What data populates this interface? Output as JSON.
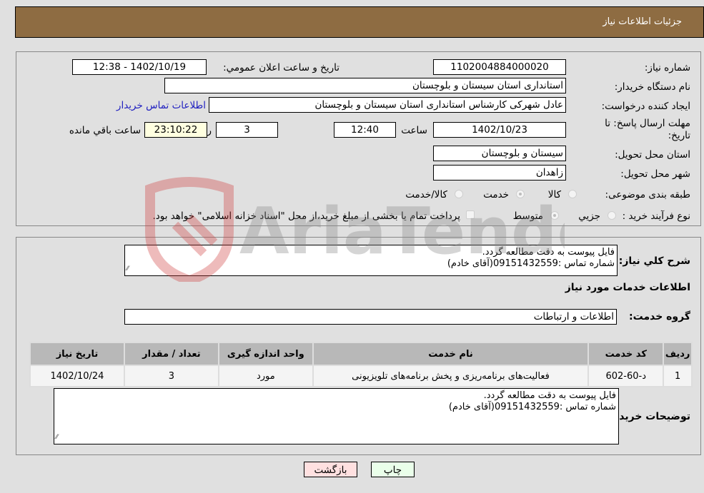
{
  "header": {
    "title": "جزئیات اطلاعات نیاز"
  },
  "form": {
    "need_number": {
      "label": "شماره نیاز:",
      "value": "1102004884000020"
    },
    "announce_datetime": {
      "label": "تاریخ و ساعت اعلان عمومي:",
      "value": "1402/10/19 - 12:38"
    },
    "buyer_org": {
      "label": "نام دستگاه خريدار:",
      "value": "استانداری استان سیستان و بلوچستان"
    },
    "requester": {
      "label": "ایجاد کننده درخواست:",
      "value": "عادل شهرکی کارشناس استانداری استان سیستان و بلوچستان"
    },
    "buyer_contact_link": "اطلاعات تماس خریدار",
    "deadline": {
      "label_line1": "مهلت ارسال پاسخ: تا",
      "label_line2": "تاریخ:",
      "date": "1402/10/23",
      "time_label": "ساعت",
      "time": "12:40",
      "days": "3",
      "days_label": "روز و",
      "remaining": "23:10:22",
      "remaining_label": "ساعت باقي مانده"
    },
    "delivery_province": {
      "label": "استان محل تحویل:",
      "value": "سیستان و بلوچستان"
    },
    "delivery_city": {
      "label": "شهر محل تحویل:",
      "value": "زاهدان"
    },
    "category": {
      "label": "طبقه بندی موضوعی:",
      "options": [
        "کالا",
        "خدمت",
        "کالا/خدمت"
      ],
      "selected": "خدمت"
    },
    "purchase_type": {
      "label": "نوع فرآیند خرید :",
      "options": [
        "جزيي",
        "متوسط"
      ],
      "selected": "متوسط",
      "treasury_note": "پرداخت تمام یا بخشی از مبلغ خرید،از محل \"اسناد خزانه اسلامی\" خواهد بود."
    }
  },
  "details": {
    "general_desc_label": "شرح کلي نياز:",
    "general_desc_lines": [
      "فایل پیوست به دقت مطالعه گردد.",
      "شماره تماس :09151432559(آقای خادم)"
    ],
    "services_heading": "اطلاعات خدمات مورد نياز",
    "service_group_label": "گروه خدمت:",
    "service_group_value": "اطلاعات و ارتباطات",
    "table": {
      "headers": [
        "ردیف",
        "کد خدمت",
        "نام خدمت",
        "واحد اندازه گیری",
        "تعداد / مقدار",
        "تاریخ نیاز"
      ],
      "rows": [
        [
          "1",
          "د-60-602",
          "فعالیت‌های برنامه‌ریزی و پخش برنامه‌های تلویزیونی",
          "مورد",
          "3",
          "1402/10/24"
        ]
      ]
    },
    "buyer_notes_label": "توضيحات خريدار:",
    "buyer_notes_lines": [
      "فایل پیوست به دقت مطالعه گردد.",
      "شماره تماس :09151432559(آقای خادم)"
    ]
  },
  "buttons": {
    "print": "چاپ",
    "back": "بازگشت"
  },
  "watermark": {
    "text": "AriaTender.neT"
  },
  "colors": {
    "header_bg": "#8e6c42",
    "print_bg": "#eaffea",
    "back_bg": "#ffe0e0",
    "link": "#2020c0"
  }
}
